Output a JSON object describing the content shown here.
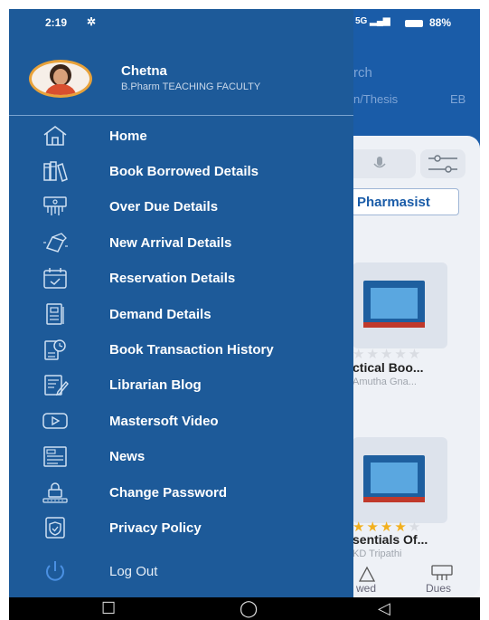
{
  "status_bar": {
    "time": "2:19",
    "network": "5G",
    "battery": "88%"
  },
  "background_app": {
    "header_tab_1": "rch",
    "header_tab_2": "n/Thesis",
    "header_tab_3": "EB",
    "chip_label": "Pharmasist",
    "book_1": {
      "title": "ctical Boo...",
      "author": "Amutha Gna..."
    },
    "book_2": {
      "title": "sentials Of...",
      "author": "KD Tripathi"
    },
    "bottom_nav": {
      "borrowed": "wed",
      "dues": "Dues"
    }
  },
  "drawer": {
    "user": {
      "name": "Chetna",
      "role": "B.Pharm  TEACHING FACULTY"
    },
    "menu": [
      {
        "label": "Home",
        "icon": "home-icon"
      },
      {
        "label": "Book Borrowed Details",
        "icon": "books-icon"
      },
      {
        "label": "Over Due Details",
        "icon": "overdue-icon"
      },
      {
        "label": "New Arrival Details",
        "icon": "new-arrival-icon"
      },
      {
        "label": "Reservation Details",
        "icon": "calendar-check-icon"
      },
      {
        "label": "Demand Details",
        "icon": "document-icon"
      },
      {
        "label": "Book Transaction History",
        "icon": "history-icon"
      },
      {
        "label": "Librarian Blog",
        "icon": "blog-icon"
      },
      {
        "label": "Mastersoft Video",
        "icon": "video-icon"
      },
      {
        "label": "News",
        "icon": "news-icon"
      },
      {
        "label": "Change Password",
        "icon": "lock-icon"
      },
      {
        "label": "Privacy Policy",
        "icon": "shield-icon"
      }
    ],
    "logout": {
      "label": "Log Out",
      "icon": "power-icon"
    }
  },
  "colors": {
    "drawer_bg": "#1d5a99",
    "header_bg": "#1a5ca8",
    "accent": "#4a90e2"
  }
}
